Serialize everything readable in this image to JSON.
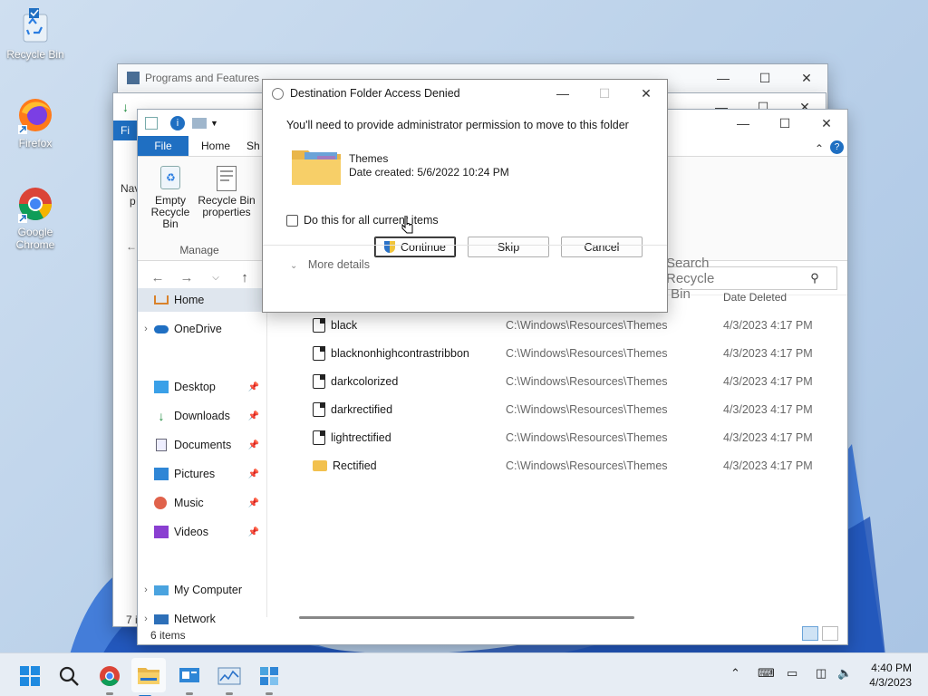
{
  "desktop": {
    "icons": [
      {
        "label": "Recycle Bin"
      },
      {
        "label": "Firefox"
      },
      {
        "label": "Google Chrome"
      }
    ]
  },
  "windows": {
    "programs_features": {
      "title": "Programs and Features"
    }
  },
  "explorer": {
    "tabs": {
      "file": "File",
      "home": "Home",
      "share": "Sh"
    },
    "ribbon": {
      "empty_bin": "Empty Recycle Bin",
      "bin_properties": "Recycle Bin properties",
      "group": "Manage"
    },
    "search_placeholder": "Search Recycle Bin",
    "sidebar": {
      "home": "Home",
      "onedrive": "OneDrive",
      "desktop": "Desktop",
      "downloads": "Downloads",
      "documents": "Documents",
      "pictures": "Pictures",
      "music": "Music",
      "videos": "Videos",
      "my_computer": "My Computer",
      "network": "Network"
    },
    "columns": {
      "date_deleted": "Date Deleted"
    },
    "rows": [
      {
        "name": "black",
        "location": "C:\\Windows\\Resources\\Themes",
        "date": "4/3/2023 4:17 PM",
        "kind": "file"
      },
      {
        "name": "blacknonhighcontrastribbon",
        "location": "C:\\Windows\\Resources\\Themes",
        "date": "4/3/2023 4:17 PM",
        "kind": "file"
      },
      {
        "name": "darkcolorized",
        "location": "C:\\Windows\\Resources\\Themes",
        "date": "4/3/2023 4:17 PM",
        "kind": "file"
      },
      {
        "name": "darkrectified",
        "location": "C:\\Windows\\Resources\\Themes",
        "date": "4/3/2023 4:17 PM",
        "kind": "file"
      },
      {
        "name": "lightrectified",
        "location": "C:\\Windows\\Resources\\Themes",
        "date": "4/3/2023 4:17 PM",
        "kind": "file"
      },
      {
        "name": "Rectified",
        "location": "C:\\Windows\\Resources\\Themes",
        "date": "4/3/2023 4:17 PM",
        "kind": "folder"
      }
    ],
    "status": "6 items",
    "back_partial_status": "7 it",
    "back_partial_ribbon": [
      "Fi",
      "Nav",
      "p"
    ]
  },
  "dialog": {
    "title": "Destination Folder Access Denied",
    "message": "You'll need to provide administrator permission to move to this folder",
    "item_name": "Themes",
    "item_date": "Date created: 5/6/2022 10:24 PM",
    "checkbox_label": "Do this for all current items",
    "continue": "Continue",
    "skip": "Skip",
    "cancel": "Cancel",
    "more_details": "More details"
  },
  "taskbar": {
    "time": "4:40 PM",
    "date": "4/3/2023"
  },
  "colors": {
    "accent": "#1f6fc2",
    "taskbar": "#e7edf4"
  }
}
